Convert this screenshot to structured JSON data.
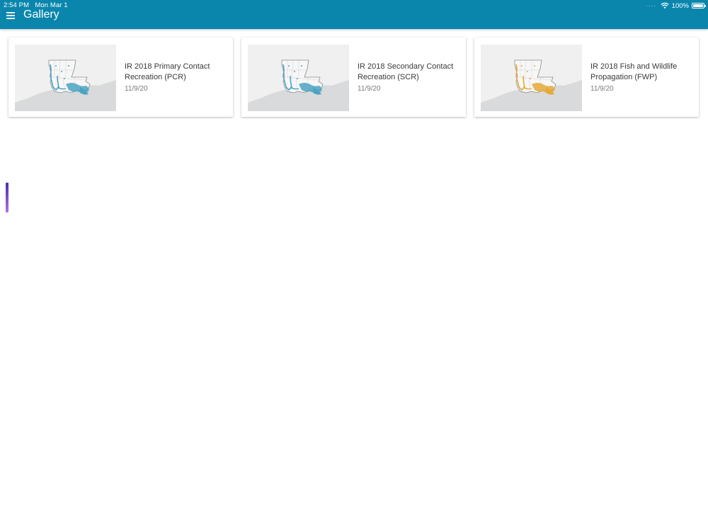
{
  "status_bar": {
    "time": "2:54 PM",
    "date": "Mon Mar 1",
    "battery": "100%",
    "battery_level": 1.0,
    "signal_icon": "signal-dots-icon",
    "wifi_icon": "wifi-icon",
    "battery_icon": "battery-icon"
  },
  "header": {
    "title": "Gallery",
    "menu_icon": "hamburger-menu-icon",
    "background_color": "#0a86ad"
  },
  "gallery": {
    "items": [
      {
        "title": "IR 2018 Primary Contact Recreation (PCR)",
        "date": "11/9/20",
        "thumbnail_icon": "louisiana-map-thumbnail",
        "accent": "#4ba3c2"
      },
      {
        "title": "IR 2018 Secondary Contact Recreation (SCR)",
        "date": "11/9/20",
        "thumbnail_icon": "louisiana-map-thumbnail",
        "accent": "#4ba3c2"
      },
      {
        "title": "IR 2018 Fish and Wildlife Propagation (FWP)",
        "date": "11/9/20",
        "thumbnail_icon": "louisiana-map-thumbnail",
        "accent": "#e5a93a"
      }
    ]
  }
}
